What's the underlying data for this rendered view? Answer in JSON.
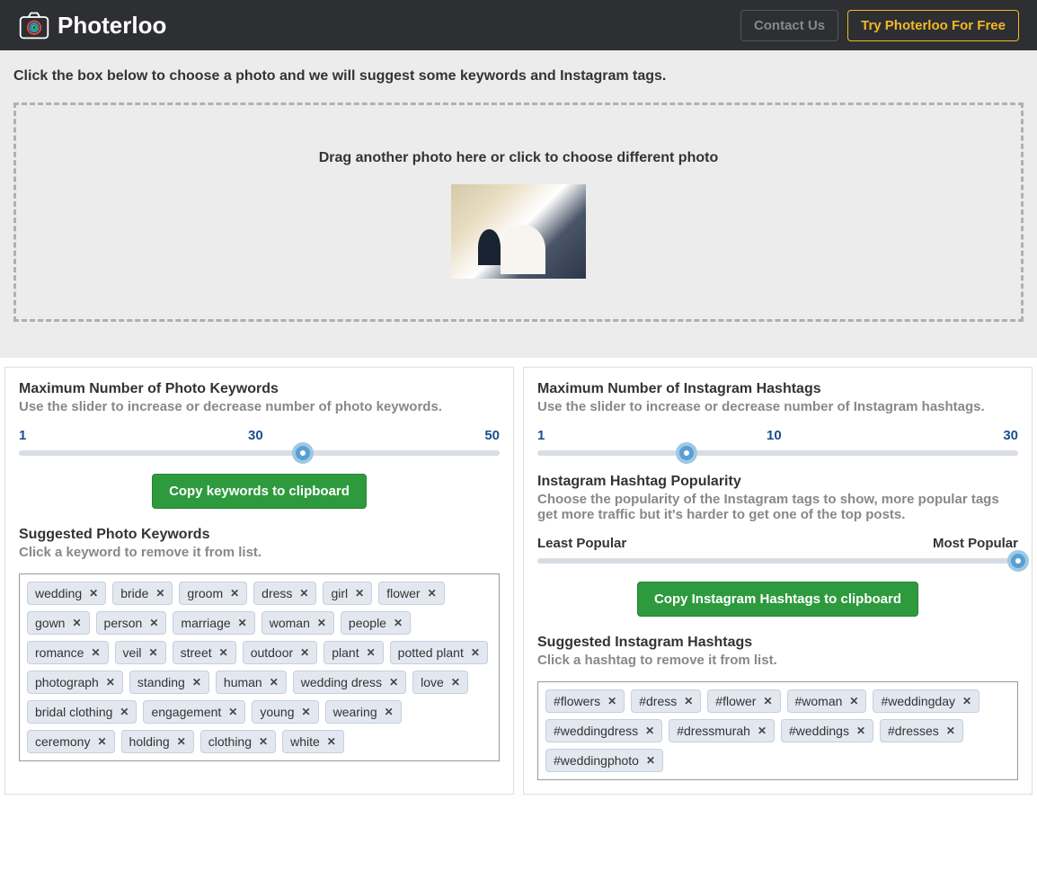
{
  "header": {
    "brand": "Photerloo",
    "contact": "Contact Us",
    "try": "Try Photerloo For Free"
  },
  "upload": {
    "instructions": "Click the box below to choose a photo and we will suggest some keywords and Instagram tags.",
    "drop_text": "Drag another photo here or click to choose different photo"
  },
  "keywords": {
    "title": "Maximum Number of Photo Keywords",
    "sub": "Use the slider to increase or decrease number of photo keywords.",
    "min": "1",
    "val": "30",
    "max": "50",
    "copy": "Copy keywords to clipboard",
    "suggested_title": "Suggested Photo Keywords",
    "suggested_sub": "Click a keyword to remove it from list.",
    "tags": [
      "wedding",
      "bride",
      "groom",
      "dress",
      "girl",
      "flower",
      "gown",
      "person",
      "marriage",
      "woman",
      "people",
      "romance",
      "veil",
      "street",
      "outdoor",
      "plant",
      "potted plant",
      "photograph",
      "standing",
      "human",
      "wedding dress",
      "love",
      "bridal clothing",
      "engagement",
      "young",
      "wearing",
      "ceremony",
      "holding",
      "clothing",
      "white"
    ]
  },
  "hashtags": {
    "title": "Maximum Number of Instagram Hashtags",
    "sub": "Use the slider to increase or decrease number of Instagram hashtags.",
    "min": "1",
    "val": "10",
    "max": "30",
    "pop_title": "Instagram Hashtag Popularity",
    "pop_sub": "Choose the popularity of the Instagram tags to show, more popular tags get more traffic but it's harder to get one of the top posts.",
    "pop_min": "Least Popular",
    "pop_max": "Most Popular",
    "copy": "Copy Instagram Hashtags to clipboard",
    "suggested_title": "Suggested Instagram Hashtags",
    "suggested_sub": "Click a hashtag to remove it from list.",
    "tags": [
      "#flowers",
      "#dress",
      "#flower",
      "#woman",
      "#weddingday",
      "#weddingdress",
      "#dressmurah",
      "#weddings",
      "#dresses",
      "#weddingphoto"
    ]
  }
}
